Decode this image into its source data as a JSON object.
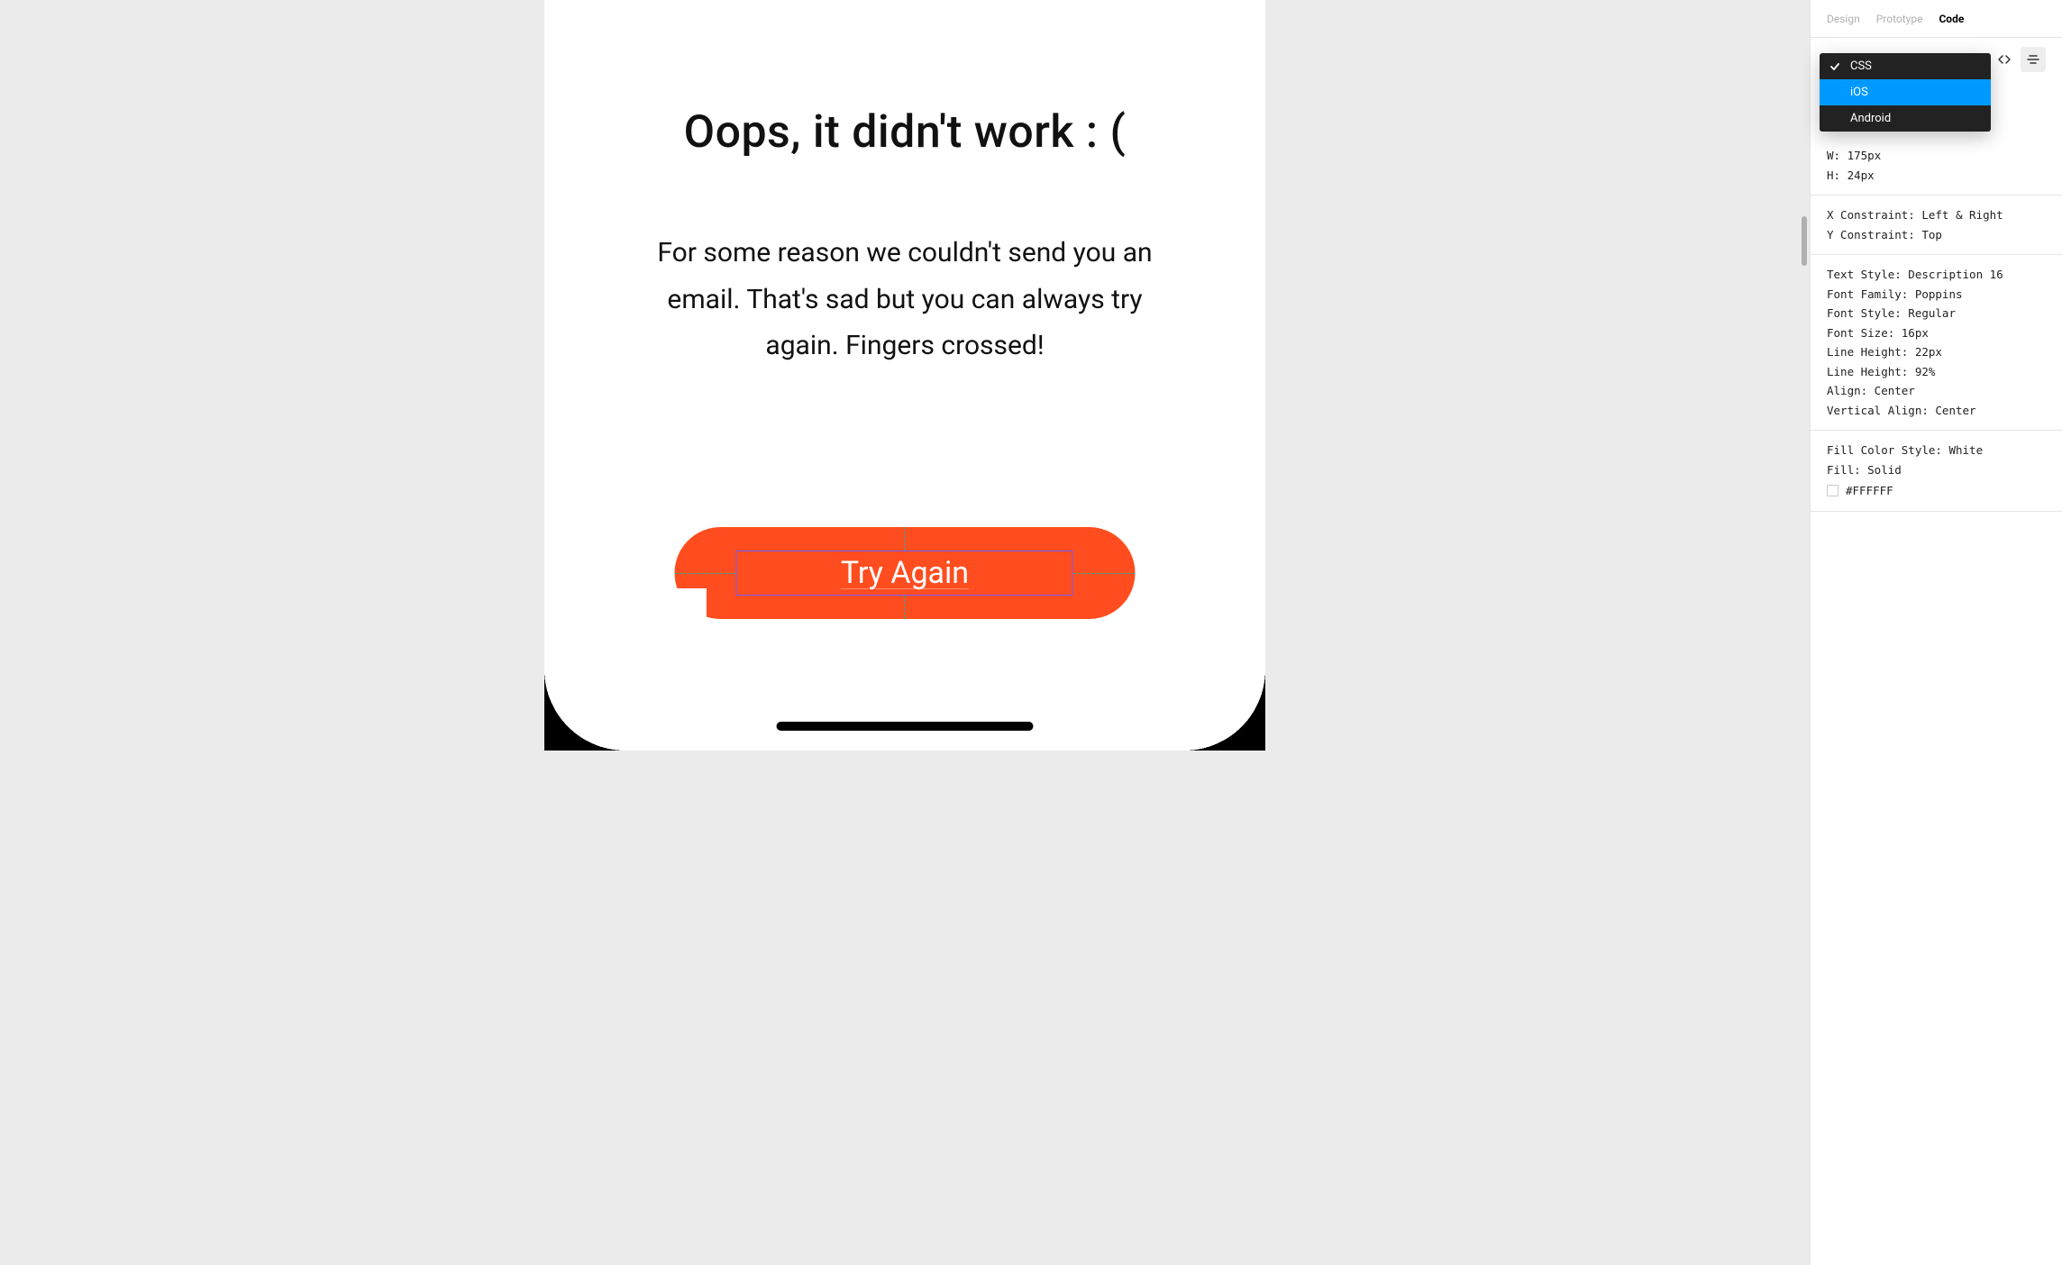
{
  "canvas": {
    "heading": "Oops, it didn't work : (",
    "body": "For some reason we couldn't send you an email. That's sad but you can always try again. Fingers crossed!",
    "button_label": "Try Again"
  },
  "inspector": {
    "tabs": {
      "design": "Design",
      "prototype": "Prototype",
      "code": "Code"
    },
    "languages": {
      "css": "CSS",
      "ios": "iOS",
      "android": "Android",
      "selected": "CSS",
      "hovered": "iOS"
    },
    "dims": {
      "w_label": "W:",
      "w_value": "175px",
      "h_label": "H:",
      "h_value": "24px"
    },
    "constraints": {
      "x": "X Constraint: Left & Right",
      "y": "Y Constraint: Top"
    },
    "text": {
      "style": "Text Style: Description 16",
      "family": "Font Family: Poppins",
      "fstyle": "Font Style: Regular",
      "size": "Font Size: 16px",
      "lh_px": "Line Height: 22px",
      "lh_pct": "Line Height: 92%",
      "align": "Align: Center",
      "valign": "Vertical Align: Center"
    },
    "fill": {
      "style": "Fill Color Style: White",
      "type": "Fill: Solid",
      "hex": "#FFFFFF"
    }
  }
}
